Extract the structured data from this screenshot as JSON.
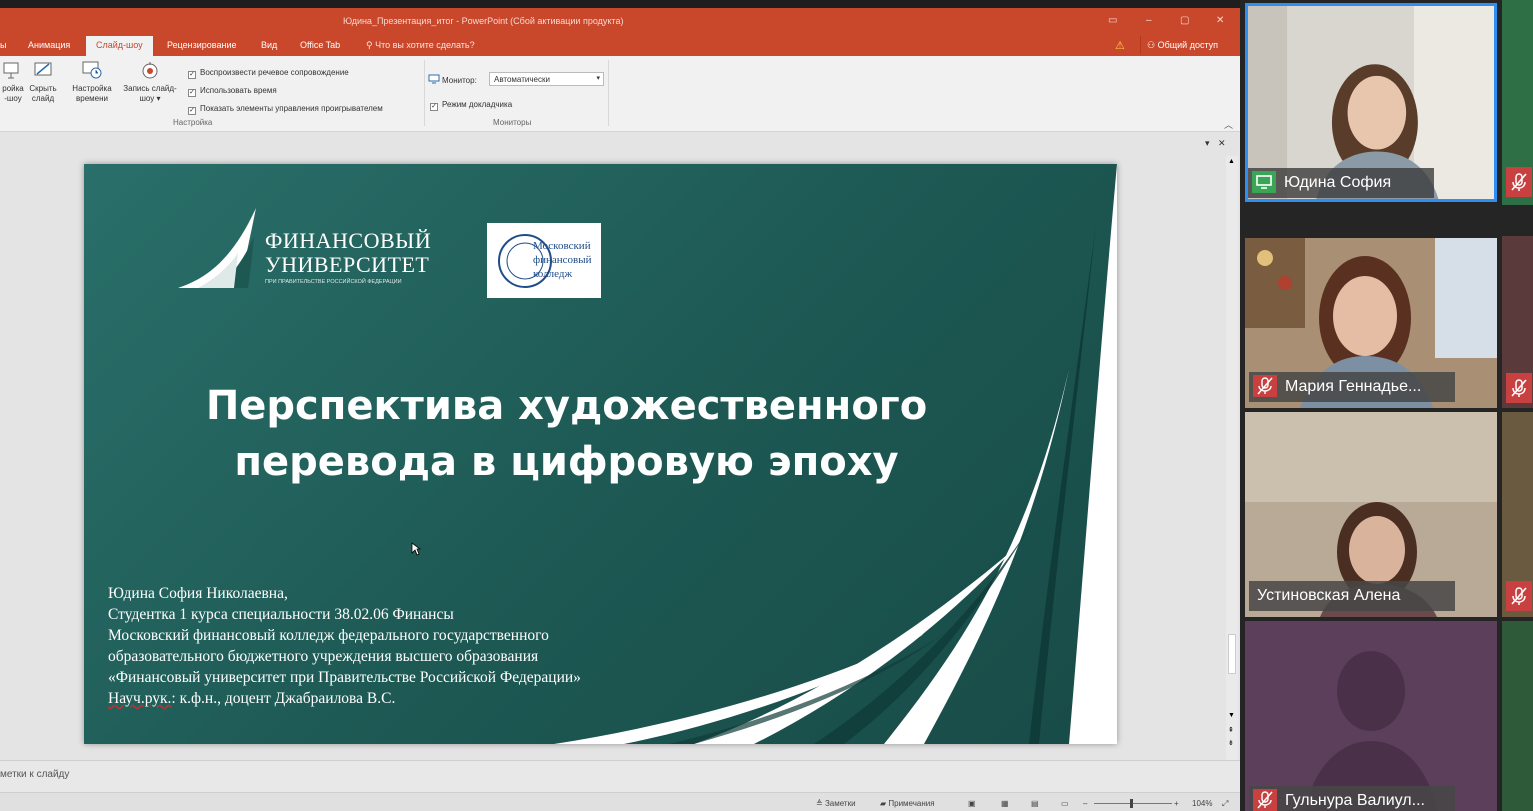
{
  "powerpoint": {
    "window_title": "Юдина_Презентация_итог - PowerPoint (Сбой активации продукта)",
    "tabs": [
      "ы",
      "Анимация",
      "Слайд-шоу",
      "Рецензирование",
      "Вид",
      "Office Tab"
    ],
    "active_tab": "Слайд-шоу",
    "search_hint": "Что вы хотите сделать?",
    "share_label": "Общий доступ",
    "ribbon": {
      "buttons": [
        {
          "label": "ройка\n-шоу"
        },
        {
          "label": "Скрыть\nслайд"
        },
        {
          "label": "Настройка\nвремени"
        },
        {
          "label": "Запись слайд-\nшоу ▾"
        }
      ],
      "checkboxes": [
        {
          "label": "Воспроизвести речевое сопровождение",
          "checked": true
        },
        {
          "label": "Использовать время",
          "checked": true
        },
        {
          "label": "Показать элементы управления проигрывателем",
          "checked": true
        }
      ],
      "setup_group_label": "Настройка",
      "monitor_label": "Монитор:",
      "monitor_value": "Автоматически",
      "presenter_label": "Режим докладчика",
      "presenter_checked": true,
      "monitors_group_label": "Мониторы"
    },
    "slide": {
      "fu_name_line1": "ФИНАНСОВЫЙ",
      "fu_name_line2": "УНИВЕРСИТЕТ",
      "fu_subtitle": "ПРИ ПРАВИТЕЛЬСТВЕ РОССИЙСКОЙ ФЕДЕРАЦИИ",
      "college_logo_text": "Московский финансовый колледж",
      "title_line1": "Перспектива художественного",
      "title_line2": "перевода в цифровую эпоху",
      "body_lines": [
        "Юдина София Николаевна,",
        "Студентка 1 курса  специальности 38.02.06 Финансы",
        "Московский финансовый колледж федерального государственного",
        "образовательного бюджетного учреждения высшего образования",
        "«Финансовый университет при Правительстве Российской Федерации»"
      ],
      "supervisor_prefix": "Науч.рук.",
      "supervisor_rest": ": к.ф.н., доцент Джабраилова В.С."
    },
    "notes_placeholder": "метки к слайду",
    "status": {
      "notes": "Заметки",
      "comments": "Примечания",
      "zoom": "104%"
    }
  },
  "call": {
    "participants": [
      {
        "name": "Юдина София",
        "sharing": true,
        "mic_muted": false
      },
      {
        "name": "Мария Геннадье...",
        "mic_muted": true
      },
      {
        "name": "Устиновская Алена",
        "mic_muted": false
      },
      {
        "name": "Гульнура Валиул...",
        "mic_muted": true
      }
    ]
  },
  "colors": {
    "ppt_accent": "#c9472b",
    "slide_teal": "#1d5853",
    "active_speaker_border": "#2e8ff0",
    "muted_red": "#c94040",
    "screen_share_green": "#3aa655"
  }
}
